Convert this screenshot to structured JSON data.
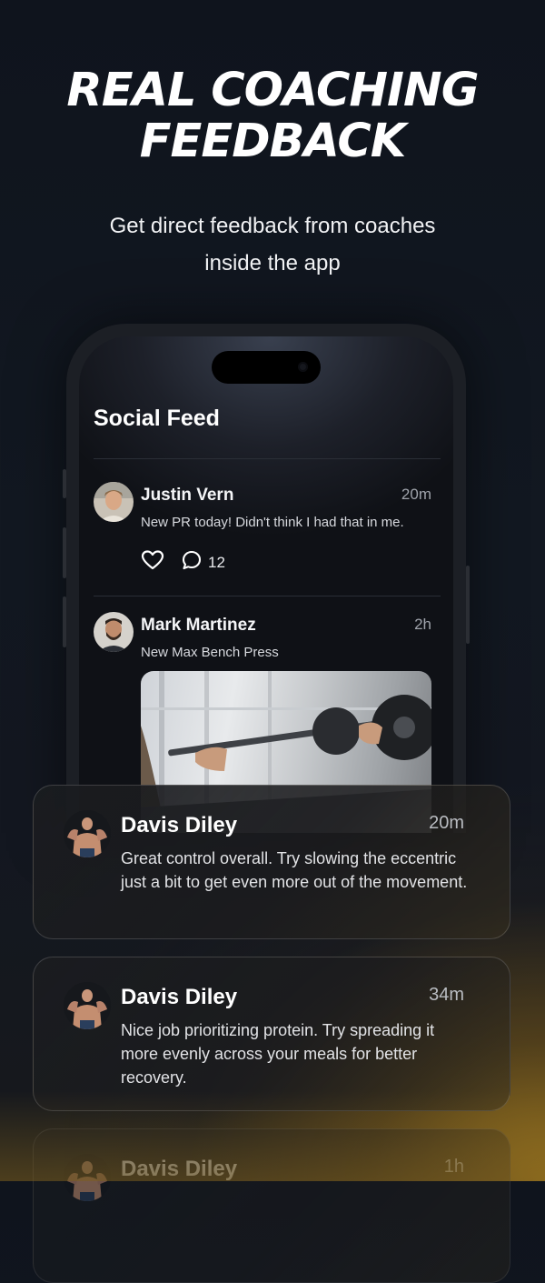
{
  "hero": {
    "title_line1": "REAL COACHING",
    "title_line2": "FEEDBACK",
    "subtitle_line1": "Get direct feedback from coaches",
    "subtitle_line2": "inside the app"
  },
  "phone": {
    "screen_title": "Social Feed",
    "posts": [
      {
        "author": "Justin Vern",
        "time": "20m",
        "text": "New PR today! Didn't think I had that in me.",
        "comment_count": "12",
        "icons": [
          "heart-icon",
          "comment-icon"
        ]
      },
      {
        "author": "Mark Martinez",
        "time": "2h",
        "text": "New Max Bench Press",
        "image": "bench-press-photo"
      }
    ]
  },
  "comments": [
    {
      "author": "Davis Diley",
      "time": "20m",
      "text": "Great control overall. Try slowing the eccentric just a bit to get even more out of the movement."
    },
    {
      "author": "Davis Diley",
      "time": "34m",
      "text": "Nice job prioritizing protein. Try spreading it more evenly across your meals for better recovery."
    },
    {
      "author": "Davis Diley",
      "time": "1h",
      "text": ""
    }
  ],
  "colors": {
    "background": "#121821",
    "accent_glow": "#c49220",
    "card_border": "#3a3b3e"
  }
}
